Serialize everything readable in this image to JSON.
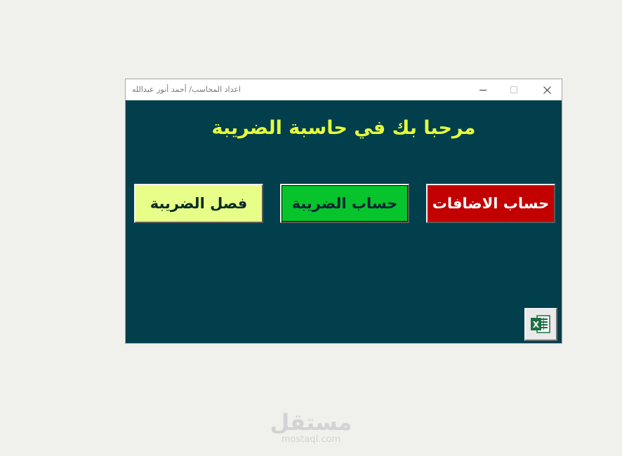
{
  "window": {
    "title": "اعداد المحاسب/ أحمد أنور عبدالله"
  },
  "main": {
    "welcome": "مرحبا بك في حاسبة الضريبة",
    "buttons": {
      "separate_tax": "فصل الضريبة",
      "calculate_tax": "حساب الضريبة",
      "calculate_additions": "حساب الاضافات"
    }
  },
  "icons": {
    "excel": "excel-icon",
    "minimize": "minimize-icon",
    "maximize": "maximize-icon",
    "close": "close-icon"
  },
  "colors": {
    "form_background": "#023f4c",
    "welcome_text": "#e6ff3c",
    "separate_button": "#e7ff89",
    "calculate_button": "#07c42c",
    "additions_button": "#c20000"
  },
  "watermark": {
    "arabic": "مستقل",
    "latin": "mostaql.com"
  }
}
